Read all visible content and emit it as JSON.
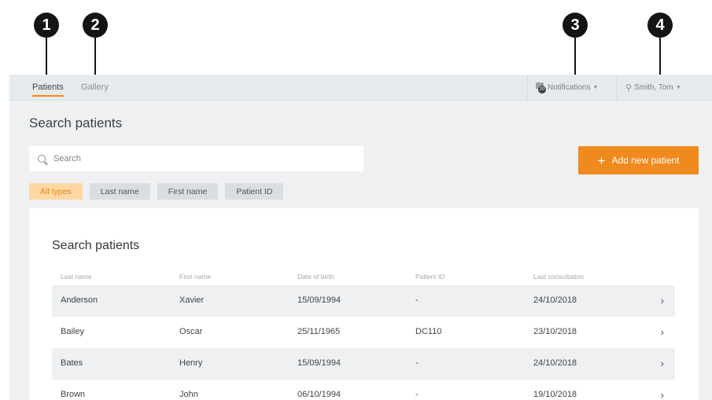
{
  "callouts": [
    "1",
    "2",
    "3",
    "4"
  ],
  "nav": {
    "tabs": [
      {
        "label": "Patients",
        "active": true
      },
      {
        "label": "Gallery",
        "active": false
      }
    ],
    "notifications": {
      "count": "20",
      "label": "Notifications"
    },
    "user": {
      "label": "Smith, Tom"
    }
  },
  "page": {
    "title": "Search patients"
  },
  "search": {
    "placeholder": "Search",
    "value": ""
  },
  "add_button": {
    "label": "Add new patient"
  },
  "filters": [
    {
      "label": "All types",
      "active": true
    },
    {
      "label": "Last name",
      "active": false
    },
    {
      "label": "First name",
      "active": false
    },
    {
      "label": "Patient ID",
      "active": false
    }
  ],
  "results": {
    "title": "Search patients",
    "columns": [
      "Last name",
      "First name",
      "Date of birth",
      "Patient ID",
      "Last consultation"
    ],
    "rows": [
      {
        "last_name": "Anderson",
        "first_name": "Xavier",
        "dob": "15/09/1994",
        "patient_id": "-",
        "last_consultation": "24/10/2018"
      },
      {
        "last_name": "Bailey",
        "first_name": "Oscar",
        "dob": "25/11/1965",
        "patient_id": "DC110",
        "last_consultation": "23/10/2018"
      },
      {
        "last_name": "Bates",
        "first_name": "Henry",
        "dob": "15/09/1994",
        "patient_id": "-",
        "last_consultation": "24/10/2018"
      },
      {
        "last_name": "Brown",
        "first_name": "John",
        "dob": "06/10/1994",
        "patient_id": "-",
        "last_consultation": "19/10/2018"
      }
    ]
  },
  "icons": {
    "search": "search-icon",
    "notifications": "notifications-icon",
    "user": "user-icon",
    "caret": "caret-down-icon",
    "row_open": "chevron-right-icon",
    "plus": "plus-icon"
  },
  "colors": {
    "accent": "#f08a1f",
    "chip_active_bg": "#fdd8a4",
    "chip_active_text": "#e48512",
    "app_bg": "#eef0f2",
    "callout": "#141414"
  }
}
